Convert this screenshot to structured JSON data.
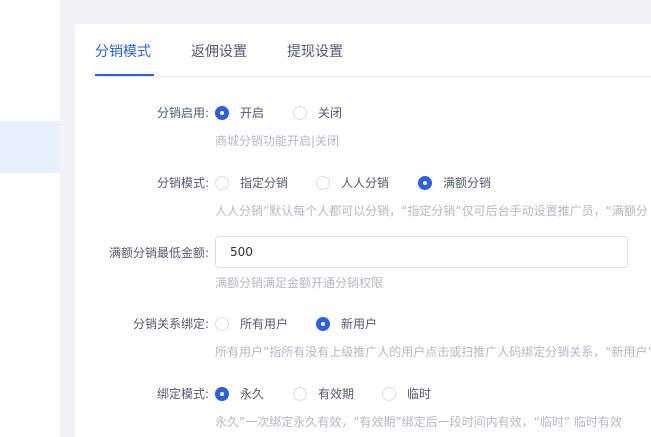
{
  "tabs": [
    {
      "label": "分销模式",
      "active": true
    },
    {
      "label": "返佣设置",
      "active": false
    },
    {
      "label": "提现设置",
      "active": false
    }
  ],
  "form": {
    "enable": {
      "label": "分销启用:",
      "options": [
        {
          "label": "开启",
          "checked": true
        },
        {
          "label": "关闭",
          "checked": false
        }
      ],
      "hint": "商城分销功能开启|关闭"
    },
    "mode": {
      "label": "分销模式:",
      "options": [
        {
          "label": "指定分销",
          "checked": false
        },
        {
          "label": "人人分销",
          "checked": false
        },
        {
          "label": "满额分销",
          "checked": true
        }
      ],
      "hint": "人人分销”默认每个人都可以分销，“指定分销”仅可后台手动设置推广员，“满额分"
    },
    "min_amount": {
      "label": "满额分销最低金额:",
      "value": "500",
      "hint": "满额分销满足金额开通分销权限"
    },
    "binding": {
      "label": "分销关系绑定:",
      "options": [
        {
          "label": "所有用户",
          "checked": false
        },
        {
          "label": "新用户",
          "checked": true
        }
      ],
      "hint": "所有用户”指所有没有上级推广人的用户点击或扫推广人码绑定分销关系，“新用户”指"
    },
    "bind_mode": {
      "label": "绑定模式:",
      "options": [
        {
          "label": "永久",
          "checked": true
        },
        {
          "label": "有效期",
          "checked": false
        },
        {
          "label": "临时",
          "checked": false
        }
      ],
      "hint": "永久”一次绑定永久有效，“有效期”绑定后一段时间内有效，“临时” 临时有效"
    }
  },
  "colors": {
    "accent": "#2d5ee8",
    "hint": "#b5b9c2",
    "border": "#dcdee2"
  }
}
